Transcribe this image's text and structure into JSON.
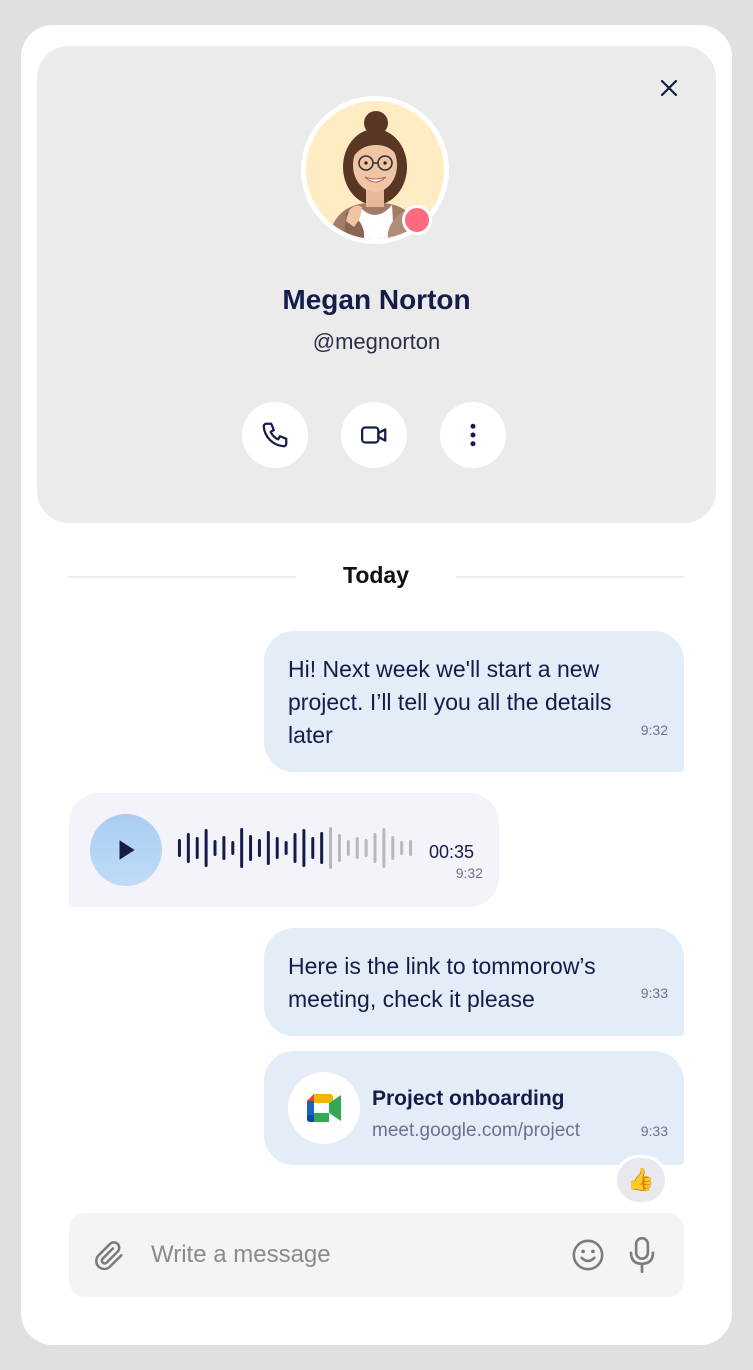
{
  "contact": {
    "name": "Megan Norton",
    "handle": "@megnorton",
    "status_color": "#ff6b7d"
  },
  "actions": [
    {
      "icon": "phone-icon"
    },
    {
      "icon": "video-camera-icon"
    },
    {
      "icon": "more-vertical-icon"
    }
  ],
  "divider": {
    "label": "Today"
  },
  "messages": {
    "m1": {
      "text": "Hi! Next week we'll start a new project. I’ll tell you all the details later",
      "time": "9:32"
    },
    "voice": {
      "duration": "00:35",
      "time": "9:32",
      "progress": 0.6
    },
    "m3": {
      "text": "Here is the link to tommorow’s meeting, check it please",
      "time": "9:33"
    },
    "link": {
      "title": "Project onboarding",
      "url": "meet.google.com/project",
      "time": "9:33",
      "icon": "google-meet-icon"
    },
    "reaction": "👍"
  },
  "composer": {
    "placeholder": "Write a message"
  },
  "colors": {
    "accent_outgoing": "#e2edf8",
    "incoming": "#f4f3fa",
    "text_dark": "#141c4a"
  }
}
